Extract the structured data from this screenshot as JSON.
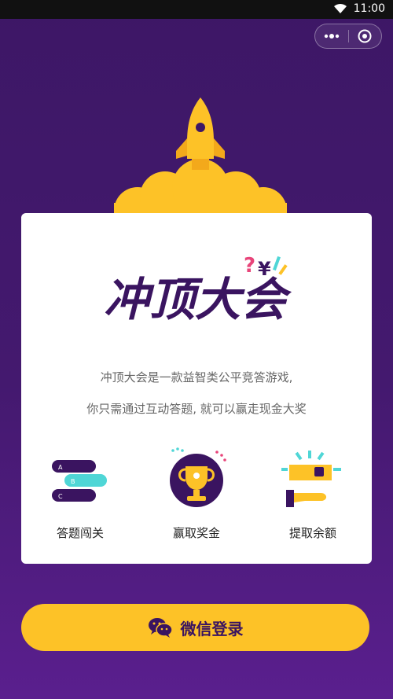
{
  "status_bar": {
    "time": "11:00"
  },
  "capsule": {
    "more_icon": "more-dots-icon",
    "close_icon": "target-circle-icon"
  },
  "brand": {
    "logo_text": "冲顶大会"
  },
  "description": {
    "line1": "冲顶大会是一款益智类公平竞答游戏,",
    "line2": "你只需通过互动答题, 就可以赢走现金大奖"
  },
  "features": [
    {
      "label": "答题闯关",
      "icon": "quiz-options-icon",
      "options": [
        "A",
        "B",
        "C"
      ]
    },
    {
      "label": "赢取奖金",
      "icon": "trophy-icon"
    },
    {
      "label": "提取余额",
      "icon": "wallet-withdraw-icon"
    }
  ],
  "login": {
    "label": "微信登录",
    "icon": "wechat-icon"
  },
  "colors": {
    "bg": "#44196f",
    "accent": "#fdc227",
    "cyan": "#4fd6d6",
    "card": "#ffffff"
  }
}
